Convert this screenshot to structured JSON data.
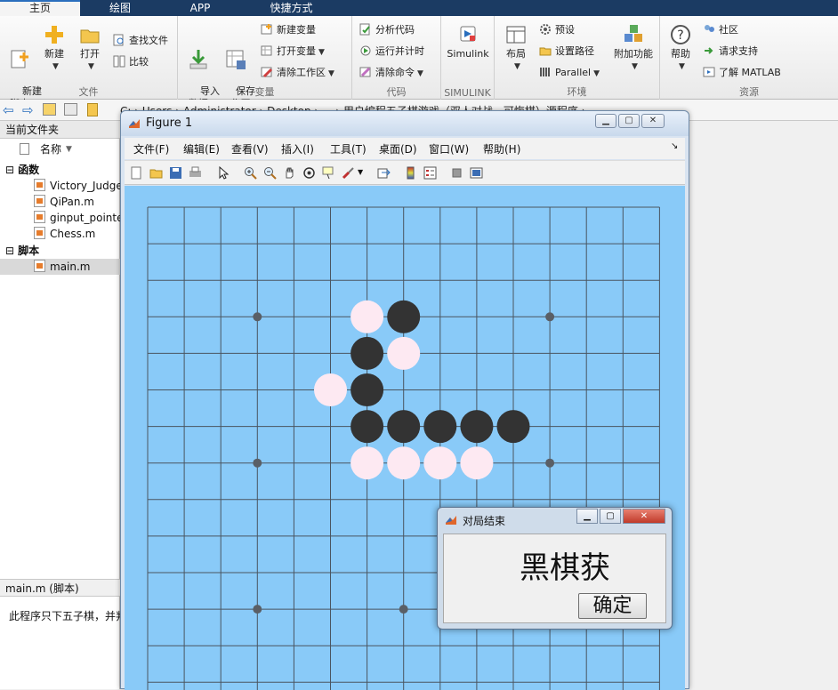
{
  "tabs": [
    {
      "label": "主页",
      "active": true
    },
    {
      "label": "绘图"
    },
    {
      "label": "APP"
    },
    {
      "label": "快捷方式"
    }
  ],
  "ribbon": {
    "file": {
      "title": "文件",
      "new_script": "新建\n脚本",
      "new": "新建",
      "open": "打开",
      "find_files": "查找文件",
      "compare": "比较"
    },
    "variable": {
      "title": "变量",
      "import": "导入\n数据",
      "save_ws": "保存\n工作区",
      "new_var": "新建变量",
      "open_var": "打开变量",
      "clear_ws": "清除工作区"
    },
    "code": {
      "title": "代码",
      "analyze": "分析代码",
      "run_time": "运行并计时",
      "clear_cmd": "清除命令"
    },
    "simulink": {
      "title": "SIMULINK",
      "label": "Simulink"
    },
    "env": {
      "title": "环境",
      "layout": "布局",
      "prefs": "预设",
      "set_path": "设置路径",
      "parallel": "Parallel",
      "addons": "附加功能"
    },
    "resources": {
      "title": "资源",
      "help": "帮助",
      "community": "社区",
      "support": "请求支持",
      "learn": "了解 MATLAB"
    }
  },
  "address": {
    "path": "C:  ›  Users  ›  Administrator  ›  Desktop  ›  ...  ›  用户编程五子棋游戏（双人对战，可悔棋）源程序  ›  ..."
  },
  "left_panel": {
    "title": "当前文件夹",
    "column": "名称",
    "sections": [
      {
        "label": "函数",
        "files": [
          "Victory_Judge.m",
          "QiPan.m",
          "ginput_pointer.m",
          "Chess.m"
        ]
      },
      {
        "label": "脚本",
        "files": [
          "main.m"
        ]
      }
    ],
    "detail_title": "main.m  (脚本)",
    "detail_text": "此程序只下五子棋，并判断胜负"
  },
  "figure": {
    "title": "Figure 1",
    "menus": [
      "文件(F)",
      "编辑(E)",
      "查看(V)",
      "插入(I)",
      "工具(T)",
      "桌面(D)",
      "窗口(W)",
      "帮助(H)"
    ],
    "board": {
      "lines": 15,
      "background": "#89caf8",
      "line_color": "#4a5560",
      "black_color": "#333333",
      "white_color": "#fde9f2",
      "star_points": [
        [
          3,
          3
        ],
        [
          11,
          3
        ],
        [
          3,
          7
        ],
        [
          11,
          7
        ],
        [
          3,
          11
        ],
        [
          7,
          11
        ]
      ],
      "black_stones": [
        [
          7,
          3
        ],
        [
          6,
          4
        ],
        [
          6,
          5
        ],
        [
          6,
          6
        ],
        [
          7,
          6
        ],
        [
          8,
          6
        ],
        [
          9,
          6
        ],
        [
          10,
          6
        ]
      ],
      "white_stones": [
        [
          6,
          3
        ],
        [
          7,
          4
        ],
        [
          5,
          5
        ],
        [
          6,
          7
        ],
        [
          7,
          7
        ],
        [
          8,
          7
        ],
        [
          9,
          7
        ]
      ]
    }
  },
  "dialog": {
    "title": "对局结束",
    "message": "黑棋获",
    "ok": "确定"
  }
}
